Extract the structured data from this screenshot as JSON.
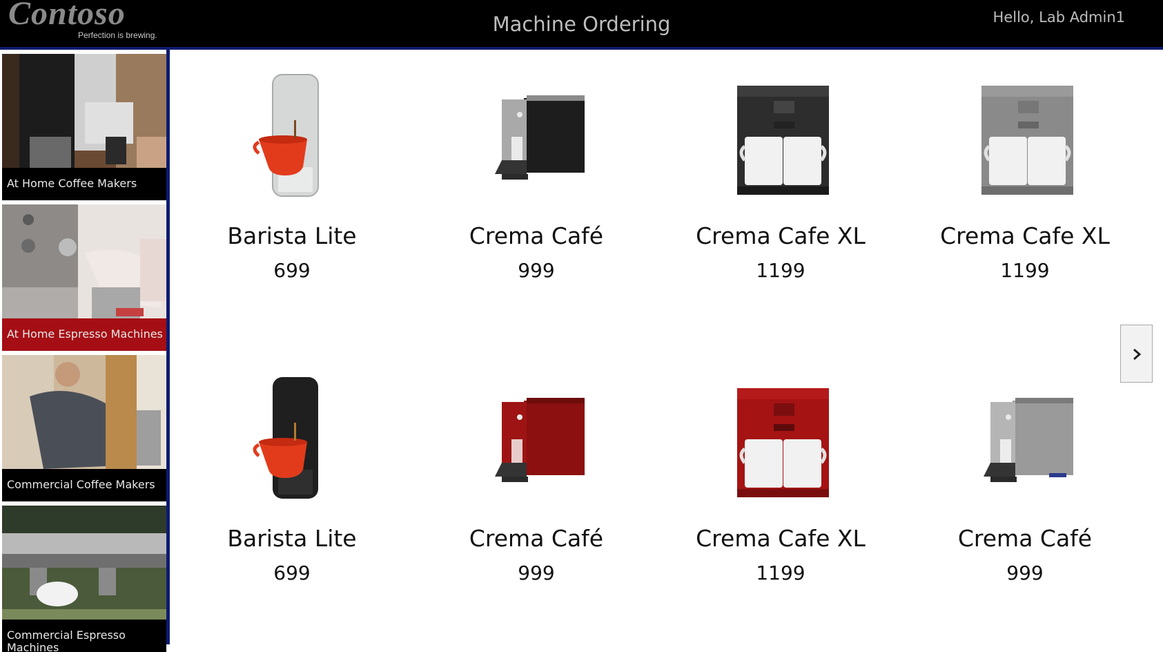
{
  "header": {
    "logo_text": "Contoso",
    "logo_tagline": "Perfection is brewing.",
    "title": "Machine Ordering",
    "greeting": "Hello, Lab Admin1"
  },
  "sidebar": {
    "items": [
      {
        "label": "At Home Coffee Makers",
        "selected": false
      },
      {
        "label": "At Home Espresso Machines",
        "selected": true
      },
      {
        "label": "Commercial Coffee Makers",
        "selected": false
      },
      {
        "label": "Commercial Espresso Machines",
        "selected": false
      }
    ],
    "selected_color": "#a50e14"
  },
  "products": [
    {
      "name": "Barista Lite",
      "price": "699",
      "image": "capsule-machine-silver"
    },
    {
      "name": "Crema Café",
      "price": "999",
      "image": "espresso-machine-black"
    },
    {
      "name": "Crema Cafe XL",
      "price": "1199",
      "image": "double-cup-machine-black"
    },
    {
      "name": "Crema Cafe XL",
      "price": "1199",
      "image": "double-cup-machine-gray"
    },
    {
      "name": "Barista Lite",
      "price": "699",
      "image": "capsule-machine-black"
    },
    {
      "name": "Crema Café",
      "price": "999",
      "image": "espresso-machine-red"
    },
    {
      "name": "Crema Cafe XL",
      "price": "1199",
      "image": "double-cup-machine-red"
    },
    {
      "name": "Crema Café",
      "price": "999",
      "image": "espresso-machine-silver"
    }
  ],
  "navigation": {
    "next_icon": "chevron-right-icon"
  },
  "colors": {
    "header_bg": "#000000",
    "accent_border": "#0d1b6e",
    "selected": "#a50e14"
  }
}
